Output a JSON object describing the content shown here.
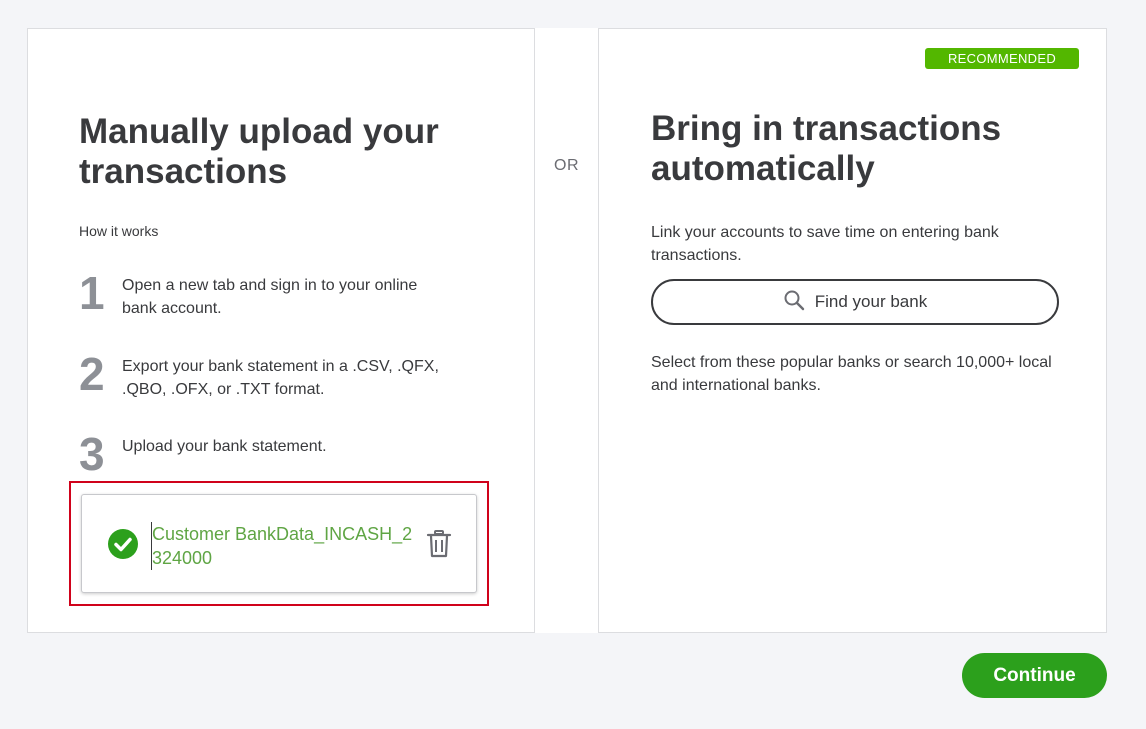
{
  "left": {
    "title": "Manually upload your transactions",
    "how_label": "How it works",
    "steps": [
      {
        "number": "1",
        "text": "Open a new tab and sign in to your online bank account."
      },
      {
        "number": "2",
        "text": "Export your bank statement in a .CSV, .QFX, .QBO, .OFX, or .TXT format."
      },
      {
        "number": "3",
        "text": "Upload your bank statement."
      }
    ],
    "uploaded_file": {
      "name": "Customer BankData_INCASH_2324000",
      "status_icon": "check-circle-icon",
      "delete_icon": "trash-icon"
    }
  },
  "divider": {
    "label": "OR"
  },
  "right": {
    "badge": "RECOMMENDED",
    "title": "Bring in transactions automatically",
    "link_description": "Link your accounts to save time on entering bank transactions.",
    "search_button": {
      "label": "Find your bank",
      "icon": "search-icon"
    },
    "popular_description": "Select from these popular banks or search 10,000+ local and international banks."
  },
  "footer": {
    "continue_label": "Continue"
  },
  "colors": {
    "accent_green": "#2ca01c",
    "badge_green": "#53b700",
    "highlight_red": "#d0021b",
    "file_text_green": "#5fa544"
  }
}
